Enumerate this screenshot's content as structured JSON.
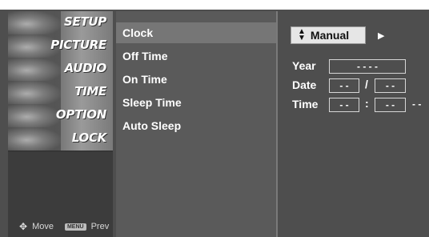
{
  "left_menu": {
    "items": [
      {
        "label": "SETUP"
      },
      {
        "label": "PICTURE"
      },
      {
        "label": "AUDIO"
      },
      {
        "label": "TIME"
      },
      {
        "label": "OPTION"
      },
      {
        "label": "LOCK"
      }
    ],
    "footer": {
      "move_label": "Move",
      "menu_key": "MENU",
      "prev_label": "Prev"
    }
  },
  "sub_menu": {
    "items": [
      {
        "label": "Clock",
        "selected": true
      },
      {
        "label": "Off Time"
      },
      {
        "label": "On Time"
      },
      {
        "label": "Sleep Time"
      },
      {
        "label": "Auto Sleep"
      }
    ]
  },
  "clock_panel": {
    "mode": "Manual",
    "year_label": "Year",
    "year_value": "- - - -",
    "date_label": "Date",
    "date_month": "- -",
    "date_sep": "/",
    "date_day": "- -",
    "time_label": "Time",
    "time_hour": "- -",
    "time_sep": ":",
    "time_minute": "- -",
    "time_ampm": "- -"
  },
  "icons": {
    "updown": "updown-arrow-icon",
    "right": "right-arrow-icon",
    "move": "dpad-move-icon"
  }
}
